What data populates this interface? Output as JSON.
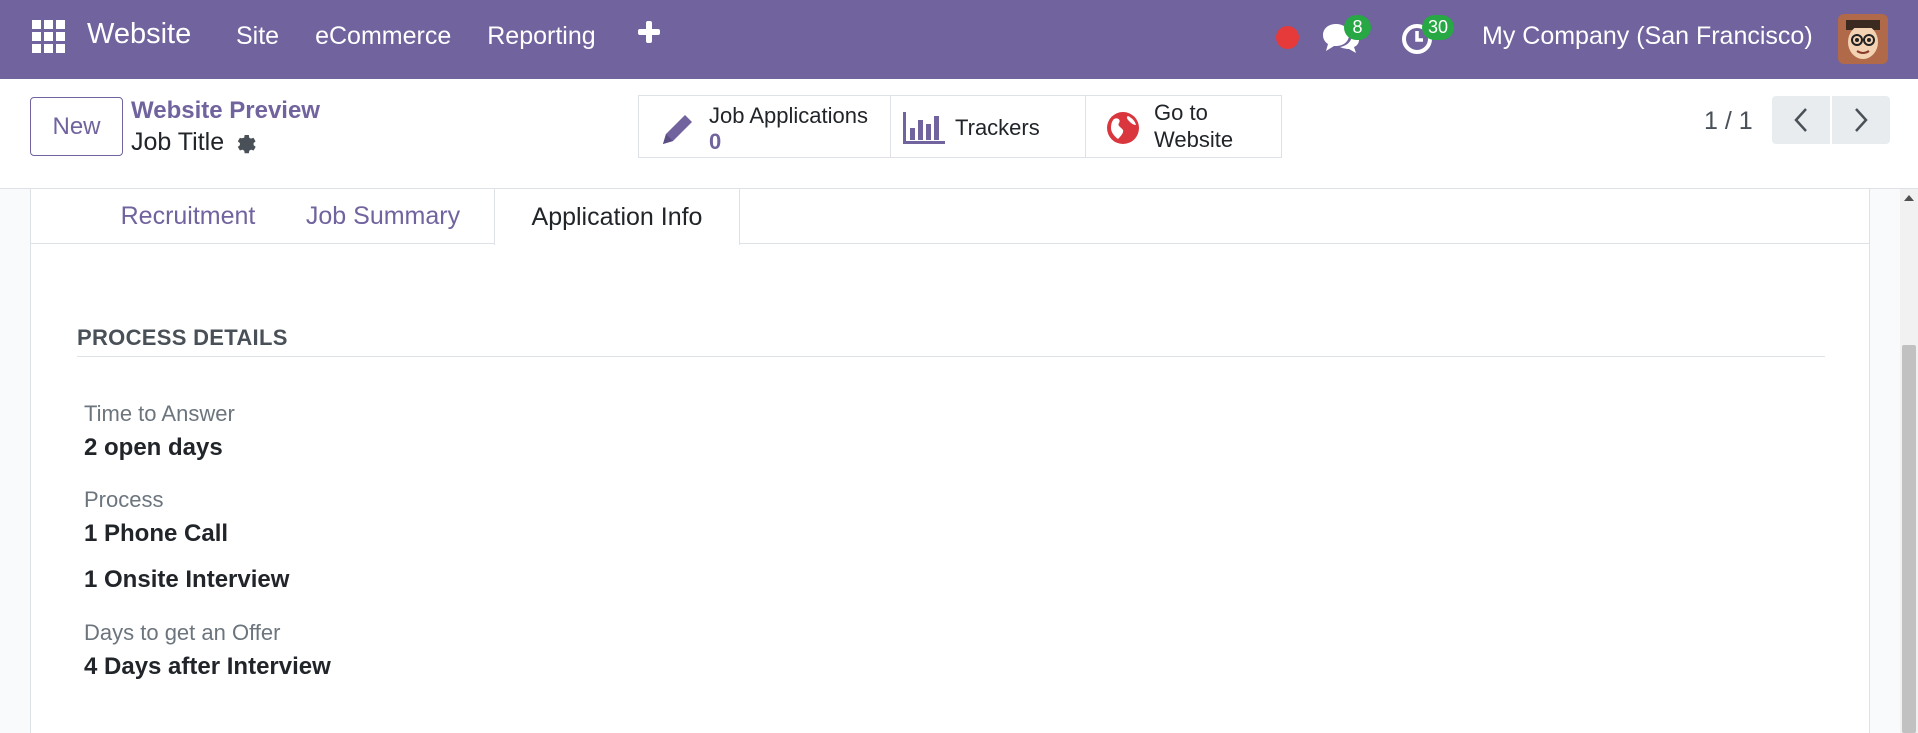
{
  "navbar": {
    "app_name": "Website",
    "menu": [
      "Site",
      "eCommerce",
      "Reporting"
    ],
    "messages_count": "8",
    "activities_count": "30",
    "company": "My Company (San Francisco)",
    "bg_color": "#71639e"
  },
  "control": {
    "new_label": "New",
    "breadcrumb": "Website Preview",
    "record_title": "Job Title",
    "smart_buttons": {
      "applications_label": "Job Applications",
      "applications_count": "0",
      "trackers_label": "Trackers",
      "website_label_1": "Go to",
      "website_label_2": "Website"
    },
    "pager": "1 / 1"
  },
  "tabs": [
    "Recruitment",
    "Job Summary",
    "Application Info"
  ],
  "active_tab": "Application Info",
  "process": {
    "title": "PROCESS DETAILS",
    "time_to_answer_label": "Time to Answer",
    "time_to_answer_value": "2 open days",
    "process_label": "Process",
    "process_step_1": "1 Phone Call",
    "process_step_2": "1 Onsite Interview",
    "offer_label": "Days to get an Offer",
    "offer_value": "4 Days after Interview"
  }
}
